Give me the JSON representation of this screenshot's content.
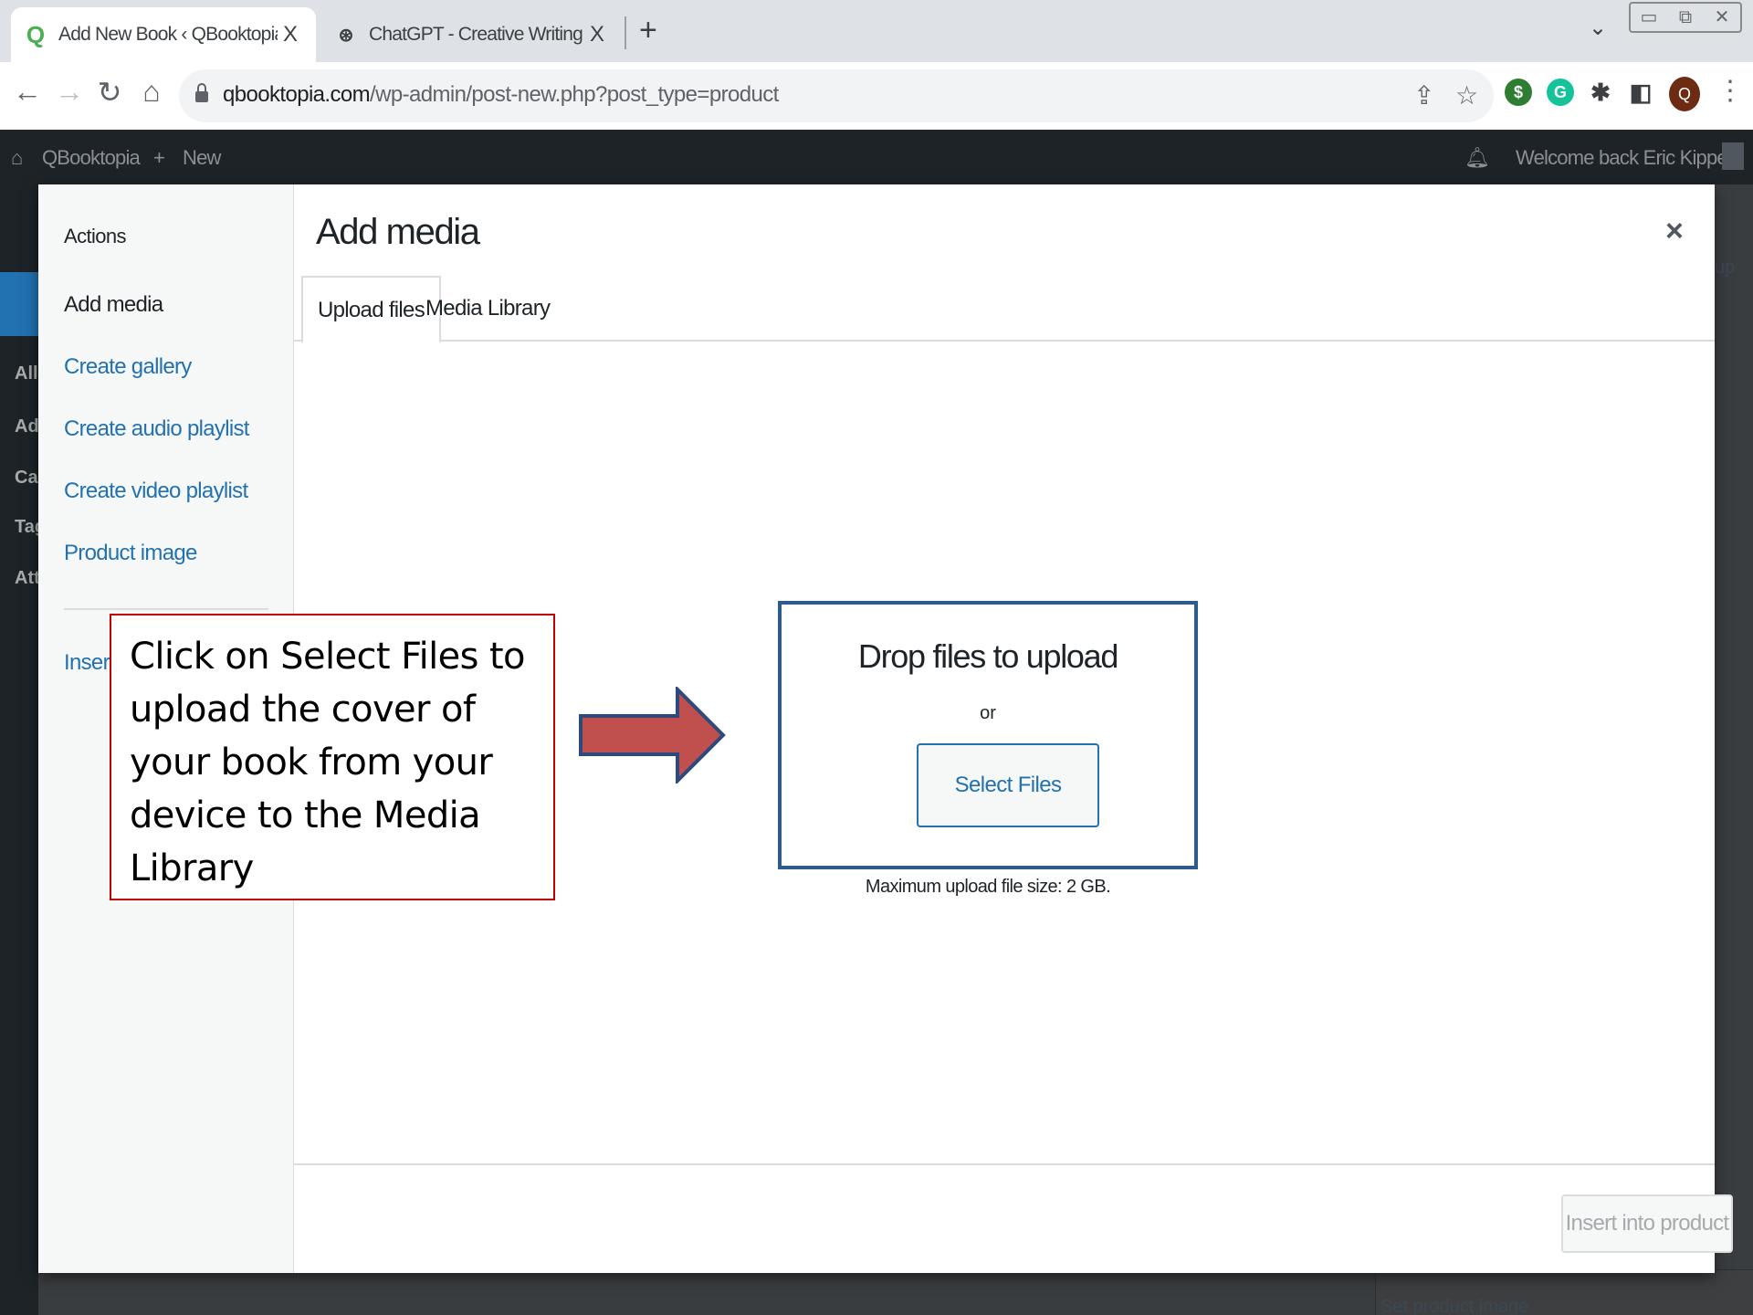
{
  "browser": {
    "tabs": [
      {
        "title": "Add New Book ‹ QBooktopia — W",
        "close": "X",
        "active": true
      },
      {
        "title": "ChatGPT - Creative Writing Coach",
        "close": "X",
        "active": false
      }
    ],
    "new_tab": "+",
    "url_host": "qbooktopia.com",
    "url_path": "/wp-admin/post-new.php?post_type=product",
    "profile_initial": "Q"
  },
  "adminbar": {
    "site_name": "QBooktopia",
    "new_label": "New",
    "welcome": "Welcome back Eric Kippen"
  },
  "background_sidebar": {
    "items": [
      "All",
      "Ad",
      "Ca",
      "Tag",
      "Att"
    ]
  },
  "background_right": {
    "set_image_link": "Set product image",
    "partial_text": "up"
  },
  "media_modal": {
    "menu_heading": "Actions",
    "menu_items": [
      "Add media",
      "Create gallery",
      "Create audio playlist",
      "Create video playlist",
      "Product image"
    ],
    "insert_link": "Insert",
    "title": "Add media",
    "close": "×",
    "tabs": [
      "Upload files",
      "Media Library"
    ],
    "drop_title": "Drop files to upload",
    "or": "or",
    "select_files": "Select Files",
    "max_upload": "Maximum upload file size: 2 GB.",
    "insert_button": "Insert into product"
  },
  "annotation": {
    "text": "Click on Select Files to upload the cover of your book from your device to the Media Library",
    "border_color": "#c00000",
    "arrow_color": "#c0504d",
    "arrow_outline": "#2e4a7d"
  }
}
